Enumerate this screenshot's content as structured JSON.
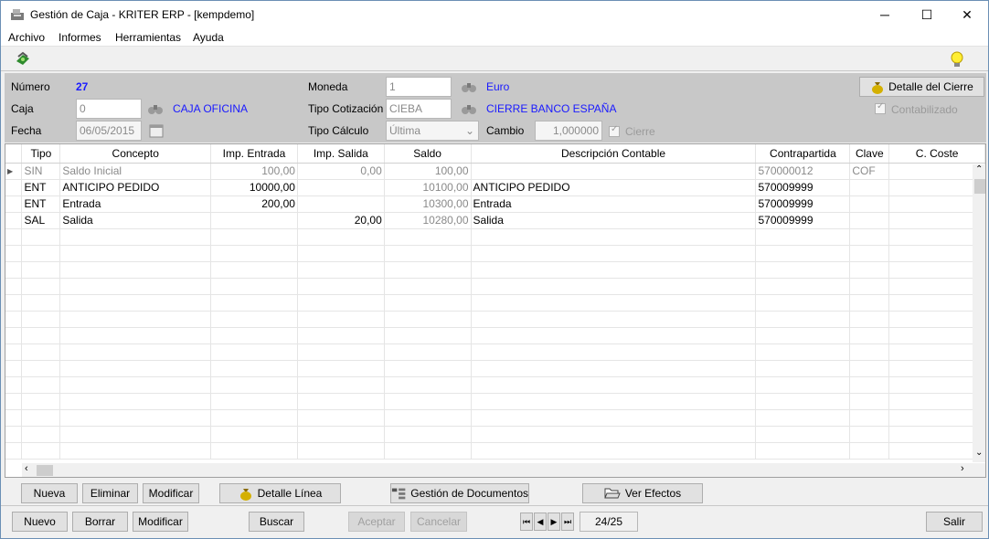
{
  "window": {
    "title": "Gestión de Caja - KRITER ERP - [kempdemo]",
    "minimize": "─",
    "maximize": "☐",
    "close": "✕"
  },
  "menu": [
    "Archivo",
    "Informes",
    "Herramientas",
    "Ayuda"
  ],
  "header": {
    "numero_label": "Número",
    "numero_value": "27",
    "caja_label": "Caja",
    "caja_value": "0",
    "caja_name": "CAJA OFICINA",
    "fecha_label": "Fecha",
    "fecha_value": "06/05/2015",
    "moneda_label": "Moneda",
    "moneda_value": "1",
    "moneda_name": "Euro",
    "tipo_cot_label": "Tipo Cotización",
    "tipo_cot_value": "CIEBA",
    "tipo_cot_name": "CIERRE BANCO ESPAÑA",
    "tipo_calc_label": "Tipo Cálculo",
    "tipo_calc_value": "Última",
    "cambio_label": "Cambio",
    "cambio_value": "1,000000",
    "cierre_label": "Cierre",
    "detalle_cierre_btn": "Detalle del Cierre",
    "contabilizado_label": "Contabilizado"
  },
  "grid": {
    "columns": [
      "Tipo",
      "Concepto",
      "Imp. Entrada",
      "Imp. Salida",
      "Saldo",
      "Descripción Contable",
      "Contrapartida",
      "Clave",
      "C. Coste"
    ],
    "rows": [
      [
        "SIN",
        "Saldo Inicial",
        "100,00",
        "0,00",
        "100,00",
        "",
        "570000012",
        "COF",
        ""
      ],
      [
        "ENT",
        "ANTICIPO PEDIDO",
        "10000,00",
        "",
        "10100,00",
        "ANTICIPO PEDIDO",
        "570009999",
        "",
        ""
      ],
      [
        "ENT",
        "Entrada",
        "200,00",
        "",
        "10300,00",
        "Entrada",
        "570009999",
        "",
        ""
      ],
      [
        "SAL",
        "Salida",
        "",
        "20,00",
        "10280,00",
        "Salida",
        "570009999",
        "",
        ""
      ]
    ]
  },
  "line_buttons": {
    "nueva": "Nueva",
    "eliminar": "Eliminar",
    "modificar": "Modificar",
    "detalle_linea": "Detalle Línea",
    "gestion_docs": "Gestión de Documentos",
    "ver_efectos": "Ver Efectos"
  },
  "bottom_buttons": {
    "nuevo": "Nuevo",
    "borrar": "Borrar",
    "modificar": "Modificar",
    "buscar": "Buscar",
    "aceptar": "Aceptar",
    "cancelar": "Cancelar",
    "salir": "Salir"
  },
  "nav": {
    "position": "24/25"
  }
}
